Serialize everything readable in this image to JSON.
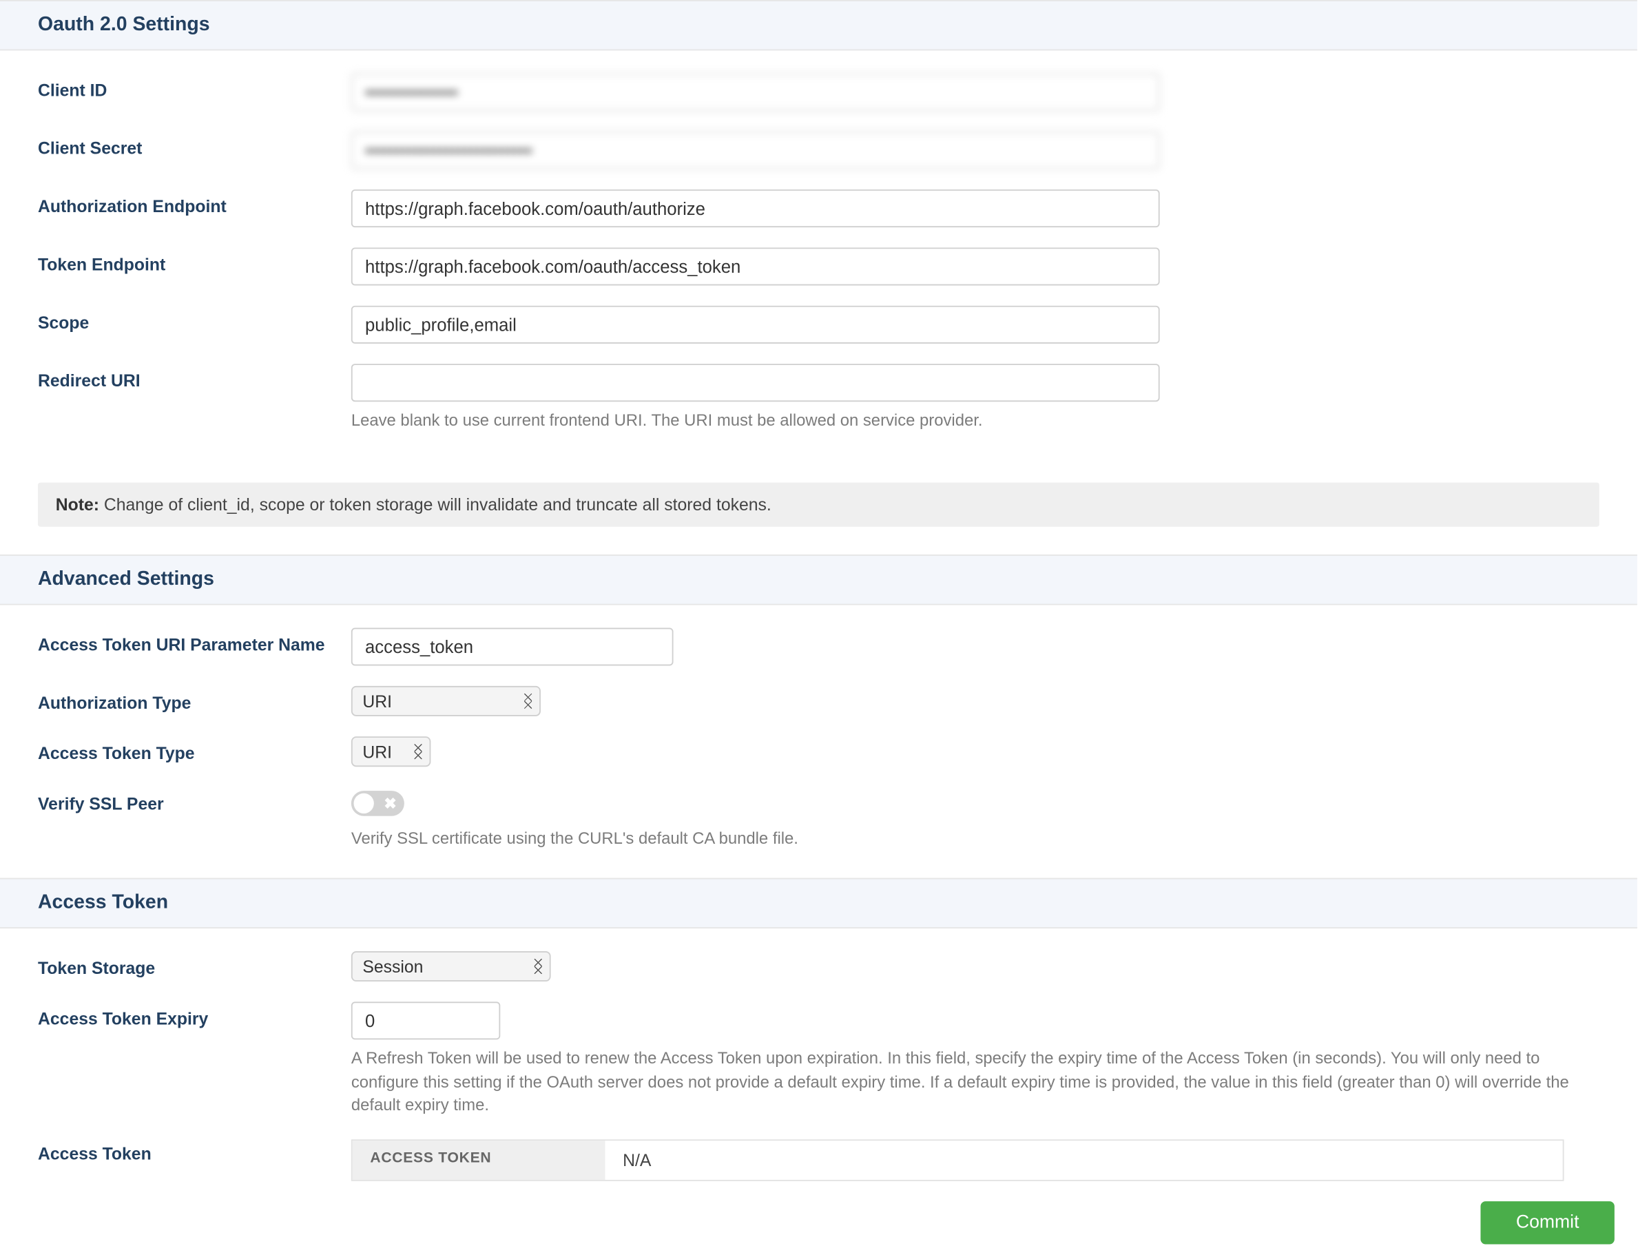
{
  "oauth": {
    "header": "Oauth 2.0 Settings",
    "client_id_label": "Client ID",
    "client_id_value": "•••••••••••••••",
    "client_secret_label": "Client Secret",
    "client_secret_value": "•••••••••••••••••••••••••••",
    "auth_endpoint_label": "Authorization Endpoint",
    "auth_endpoint_value": "https://graph.facebook.com/oauth/authorize",
    "token_endpoint_label": "Token Endpoint",
    "token_endpoint_value": "https://graph.facebook.com/oauth/access_token",
    "scope_label": "Scope",
    "scope_value": "public_profile,email",
    "redirect_uri_label": "Redirect URI",
    "redirect_uri_value": "",
    "redirect_uri_help": "Leave blank to use current frontend URI. The URI must be allowed on service provider.",
    "note_strong": "Note:",
    "note_text": " Change of client_id, scope or token storage will invalidate and truncate all stored tokens."
  },
  "advanced": {
    "header": "Advanced Settings",
    "param_name_label": "Access Token URI Parameter Name",
    "param_name_value": "access_token",
    "auth_type_label": "Authorization Type",
    "auth_type_value": "URI",
    "access_token_type_label": "Access Token Type",
    "access_token_type_value": "URI",
    "verify_ssl_label": "Verify SSL Peer",
    "verify_ssl_help": "Verify SSL certificate using the CURL's default CA bundle file.",
    "verify_ssl_on": false
  },
  "access_token": {
    "header": "Access Token",
    "token_storage_label": "Token Storage",
    "token_storage_value": "Session",
    "expiry_label": "Access Token Expiry",
    "expiry_value": "0",
    "expiry_help": "A Refresh Token will be used to renew the Access Token upon expiration. In this field, specify the expiry time of the Access Token (in seconds). You will only need to configure this setting if the OAuth server does not provide a default expiry time. If a default expiry time is provided, the value in this field (greater than 0) will override the default expiry time.",
    "access_token_label": "Access Token",
    "th_access_token": "ACCESS TOKEN",
    "na_value": "N/A"
  },
  "actions": {
    "commit": "Commit"
  }
}
